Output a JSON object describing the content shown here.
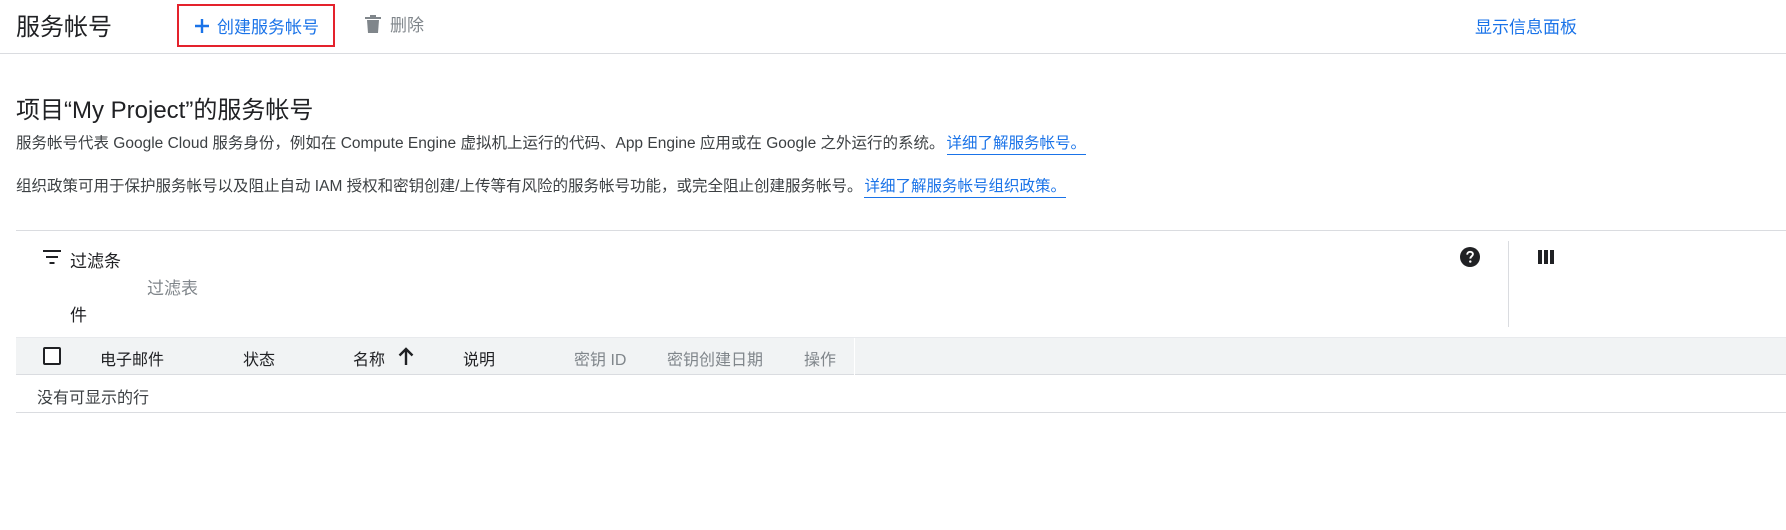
{
  "topbar": {
    "title": "服务帐号",
    "create_label": "创建服务帐号",
    "delete_label": "删除",
    "info_link": "显示信息面板"
  },
  "page": {
    "heading": "项目“My Project”的服务帐号",
    "desc1": "服务帐号代表 Google Cloud 服务身份，例如在 Compute Engine 虚拟机上运行的代码、App Engine 应用或在 Google 之外运行的系统。",
    "desc1_link": "详细了解服务帐号。",
    "desc2": "组织政策可用于保护服务帐号以及阻止自动 IAM 授权和密钥创建/上传等有风险的服务帐号功能，或完全阻止创建服务帐号。",
    "desc2_link": "详细了解服务帐号组织政策。"
  },
  "filter": {
    "label_line1": "过滤条",
    "label_line2": "件",
    "placeholder": "过滤表"
  },
  "table": {
    "columns": [
      "电子邮件",
      "状态",
      "名称",
      "说明",
      "密钥 ID",
      "密钥创建日期",
      "操作"
    ],
    "sorted_column": "名称",
    "sort_direction": "ascending",
    "empty_text": "没有可显示的行"
  },
  "colors": {
    "accent": "#1a73e8",
    "highlight_border": "#e4222c",
    "text": "#202124",
    "muted": "#80868b"
  },
  "icons": [
    "plus-icon",
    "trash-icon",
    "filter-icon",
    "help-icon",
    "columns-icon",
    "arrow-up-icon"
  ]
}
